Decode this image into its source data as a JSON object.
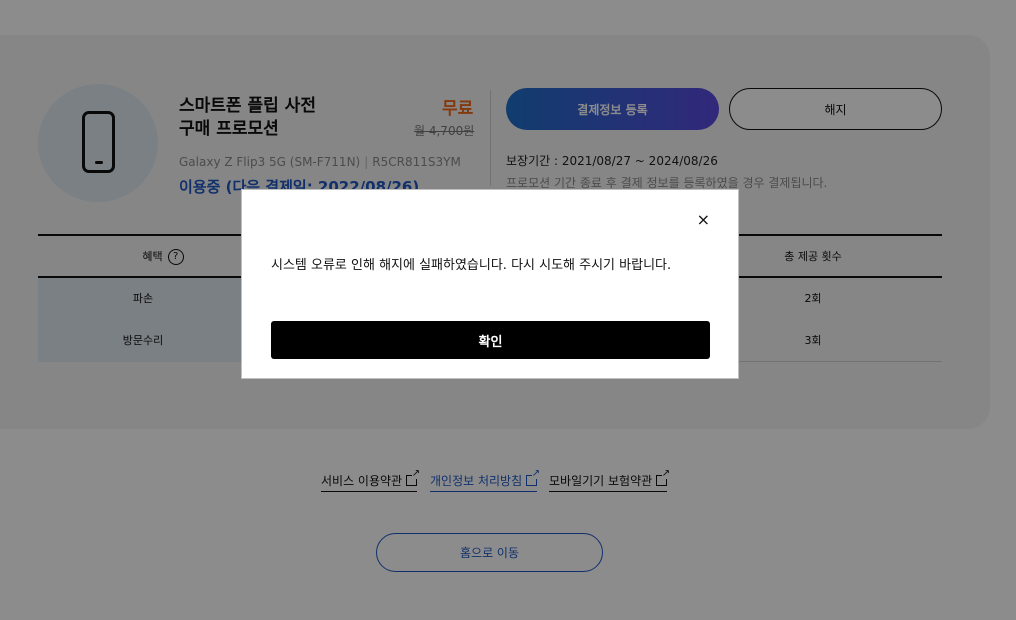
{
  "product": {
    "title_line1": "스마트폰 플립 사전",
    "title_line2": "구매 프로모션",
    "price_label": "무료",
    "original_price": "월 4,700원",
    "device_model": "Galaxy Z Flip3 5G (SM-F711N)",
    "device_separator": "|",
    "serial_number": "R5CR811S3YM",
    "status": "이용중 (다음 결제일: 2022/08/26)",
    "icon": "smartphone-icon"
  },
  "actions": {
    "register_payment_label": "결제정보 등록",
    "cancel_label": "해지"
  },
  "coverage": {
    "period": "보장기간 : 2021/08/27 ~ 2024/08/26",
    "notice": "프로모션 기간 종료 후 결제 정보를 등록하였을 경우 결제됩니다."
  },
  "benefits_table": {
    "header_benefit": "혜택",
    "header_help_icon_text": "?",
    "header_total": "총 제공 횟수",
    "rows": [
      {
        "name": "파손",
        "count": "2회"
      },
      {
        "name": "방문수리",
        "count": "3회"
      }
    ]
  },
  "footer": {
    "links": [
      {
        "label": "서비스 이용약관"
      },
      {
        "label": "개인정보 처리방침"
      },
      {
        "label": "모바일기기 보험약관"
      }
    ],
    "home_button": "홈으로 이동"
  },
  "modal": {
    "close_glyph": "×",
    "message": "시스템 오류로 인해 해지에 실패하였습니다. 다시 시도해 주시기 바랍니다.",
    "confirm_label": "확인"
  },
  "colors": {
    "accent_orange": "#f06a1a",
    "link_blue": "#1f58c4",
    "card_bg": "#f4f4f4",
    "circle_bg": "#dfe9f1"
  }
}
